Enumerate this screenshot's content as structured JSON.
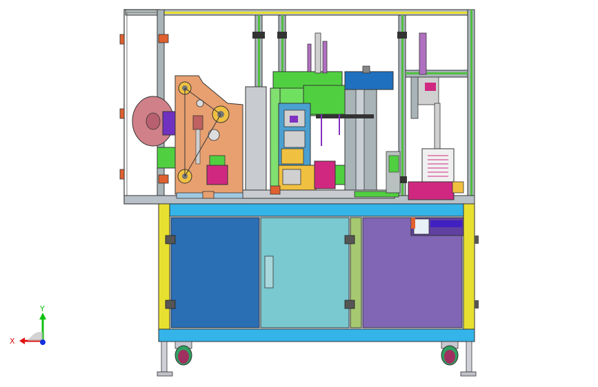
{
  "viewport": {
    "background": "#ffffff"
  },
  "triad": {
    "x_label": "X",
    "y_label": "Y",
    "x_color": "#e01010",
    "y_color": "#10c010",
    "z_color": "#1030e0"
  },
  "model": {
    "frame_color": "#a8b4b8",
    "cabinet_top_color": "#34b4e8",
    "cabinet_post_color": "#e8e030",
    "door_left_color": "#2a6eb4",
    "door_middle_color": "#7ac8d0",
    "door_right_color": "#8066b4",
    "spacer_color": "#a6c870",
    "mechanism_plate_color": "#e8a070",
    "green_block_color": "#50d040",
    "magenta_part_color": "#d02880"
  }
}
